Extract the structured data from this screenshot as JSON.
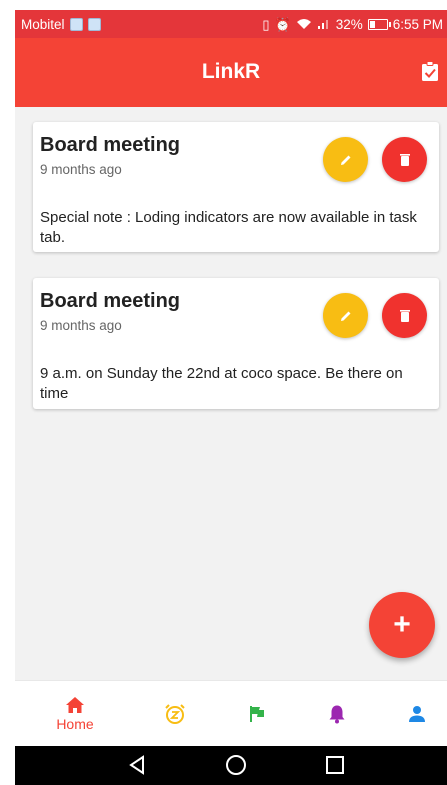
{
  "status_bar": {
    "carrier": "Mobitel",
    "battery_text": "32%",
    "battery_level": 0.32,
    "time": "6:55 PM",
    "icons": [
      "notification-icon",
      "vibrate-icon",
      "alarm-icon",
      "wifi-icon",
      "signal-icon",
      "battery-icon"
    ]
  },
  "app_bar": {
    "title": "LinkR",
    "action_icon": "clipboard-check-icon"
  },
  "cards": [
    {
      "title": "Board meeting",
      "time_ago": "9 months ago",
      "body": "Special note : Loding indicators are now available in task tab."
    },
    {
      "title": "Board meeting",
      "time_ago": "9 months ago",
      "body": "9 a.m. on Sunday the 22nd at coco space. Be there on time"
    }
  ],
  "fab": {
    "label": "+"
  },
  "bottom_nav": {
    "items": [
      {
        "label": "Home",
        "icon": "home-icon",
        "active": true,
        "color": "#f44336"
      },
      {
        "label": "",
        "icon": "alarm-snooze-icon",
        "active": false,
        "color": "#f8bd13"
      },
      {
        "label": "",
        "icon": "flag-icon",
        "active": false,
        "color": "#34b34a"
      },
      {
        "label": "",
        "icon": "bell-icon",
        "active": false,
        "color": "#9c27b0"
      },
      {
        "label": "",
        "icon": "person-icon",
        "active": false,
        "color": "#1e88e5"
      }
    ]
  },
  "system_nav": {
    "icons": [
      "back-icon",
      "home-circle-icon",
      "recents-icon"
    ]
  },
  "colors": {
    "primary": "#f44336",
    "status_bar": "#e4363a",
    "edit": "#f8bd13",
    "delete": "#f0322e",
    "background": "#f2f2f2"
  }
}
